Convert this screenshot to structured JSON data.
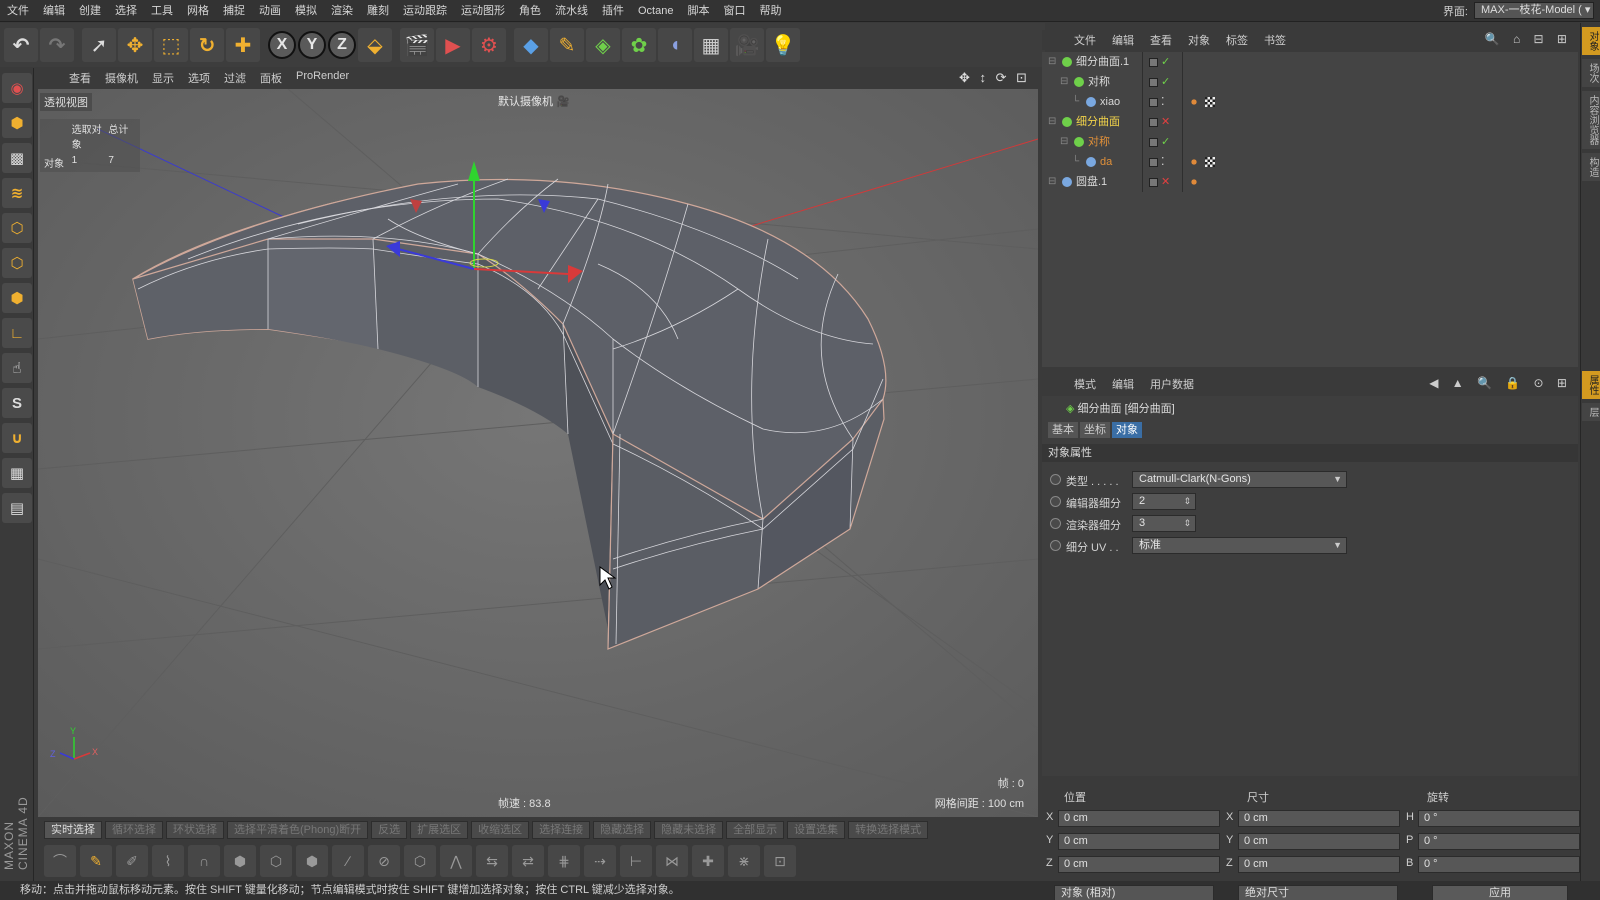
{
  "menu": [
    "文件",
    "编辑",
    "创建",
    "选择",
    "工具",
    "网格",
    "捕捉",
    "动画",
    "模拟",
    "渲染",
    "雕刻",
    "运动跟踪",
    "运动图形",
    "角色",
    "流水线",
    "插件",
    "Octane",
    "脚本",
    "窗口",
    "帮助"
  ],
  "layout": {
    "label": "界面:",
    "value": "MAX-一枝花-Model ("
  },
  "viewport_menu": [
    "查看",
    "摄像机",
    "显示",
    "选项",
    "过滤",
    "面板",
    "ProRender"
  ],
  "viewport": {
    "label": "透视视图",
    "camera": "默认摄像机",
    "stats_header": [
      "",
      "选取对象",
      "总计"
    ],
    "stats_row": [
      "对象",
      "1",
      "7"
    ],
    "fps": "帧速 : 83.8",
    "grid": "网格间距 : 100 cm",
    "frame": "帧 : 0"
  },
  "selection_tools": [
    "实时选择",
    "循环选择",
    "环状选择",
    "选择平滑着色(Phong)断开",
    "反选",
    "扩展选区",
    "收缩选区",
    "选择连接",
    "隐藏选择",
    "隐藏未选择",
    "全部显示",
    "设置选集",
    "转换选择模式"
  ],
  "status": "移动：点击并拖动鼠标移动元素。按住 SHIFT 键量化移动；节点编辑模式时按住 SHIFT 键增加选择对象；按住 CTRL 键减少选择对象。",
  "maxon": "MAXON CINEMA 4D",
  "object_manager": {
    "menu": [
      "文件",
      "编辑",
      "查看",
      "对象",
      "标签",
      "书签"
    ],
    "objects": [
      {
        "name": "细分曲面.1",
        "depth": 0,
        "color": "#6fd04a",
        "flag": "check",
        "highlight": false,
        "tags": []
      },
      {
        "name": "对称",
        "depth": 1,
        "color": "#6fd04a",
        "flag": "check",
        "highlight": false,
        "tags": []
      },
      {
        "name": "xiao",
        "depth": 2,
        "color": "#7aa8e0",
        "flag": "dot",
        "highlight": false,
        "tags": [
          "phong",
          "checker"
        ]
      },
      {
        "name": "细分曲面",
        "depth": 0,
        "color": "#6fd04a",
        "flag": "x",
        "highlight": "yellow",
        "tags": []
      },
      {
        "name": "对称",
        "depth": 1,
        "color": "#6fd04a",
        "flag": "check",
        "highlight": "orange",
        "tags": []
      },
      {
        "name": "da",
        "depth": 2,
        "color": "#7aa8e0",
        "flag": "dot",
        "highlight": "orange",
        "tags": [
          "phong",
          "checker"
        ]
      },
      {
        "name": "圆盘.1",
        "depth": 0,
        "color": "#7aa8e0",
        "flag": "x",
        "highlight": false,
        "tags": [
          "phong"
        ]
      }
    ]
  },
  "attributes": {
    "menu": [
      "模式",
      "编辑",
      "用户数据"
    ],
    "title": "细分曲面 [细分曲面]",
    "tabs": [
      {
        "label": "基本",
        "active": false
      },
      {
        "label": "坐标",
        "active": false
      },
      {
        "label": "对象",
        "active": true
      }
    ],
    "section": "对象属性",
    "rows": [
      {
        "label": "类型 . . . . .",
        "value": "Catmull-Clark(N-Gons)",
        "kind": "dropdown"
      },
      {
        "label": "编辑器细分",
        "value": "2",
        "kind": "stepper"
      },
      {
        "label": "渲染器细分",
        "value": "3",
        "kind": "stepper"
      },
      {
        "label": "细分 UV . .",
        "value": "标准",
        "kind": "dropdown"
      }
    ]
  },
  "right_tabs": [
    "对象",
    "场次",
    "内容浏览器",
    "构造",
    "属性",
    "层"
  ],
  "coordinates": {
    "headers": [
      "位置",
      "尺寸",
      "旋转"
    ],
    "position": [
      [
        "X",
        "0 cm"
      ],
      [
        "Y",
        "0 cm"
      ],
      [
        "Z",
        "0 cm"
      ]
    ],
    "size": [
      [
        "X",
        "0 cm"
      ],
      [
        "Y",
        "0 cm"
      ],
      [
        "Z",
        "0 cm"
      ]
    ],
    "rotation": [
      [
        "H",
        "0 °"
      ],
      [
        "P",
        "0 °"
      ],
      [
        "B",
        "0 °"
      ]
    ],
    "mode1": "对象 (相对)",
    "mode2": "绝对尺寸",
    "apply": "应用"
  }
}
